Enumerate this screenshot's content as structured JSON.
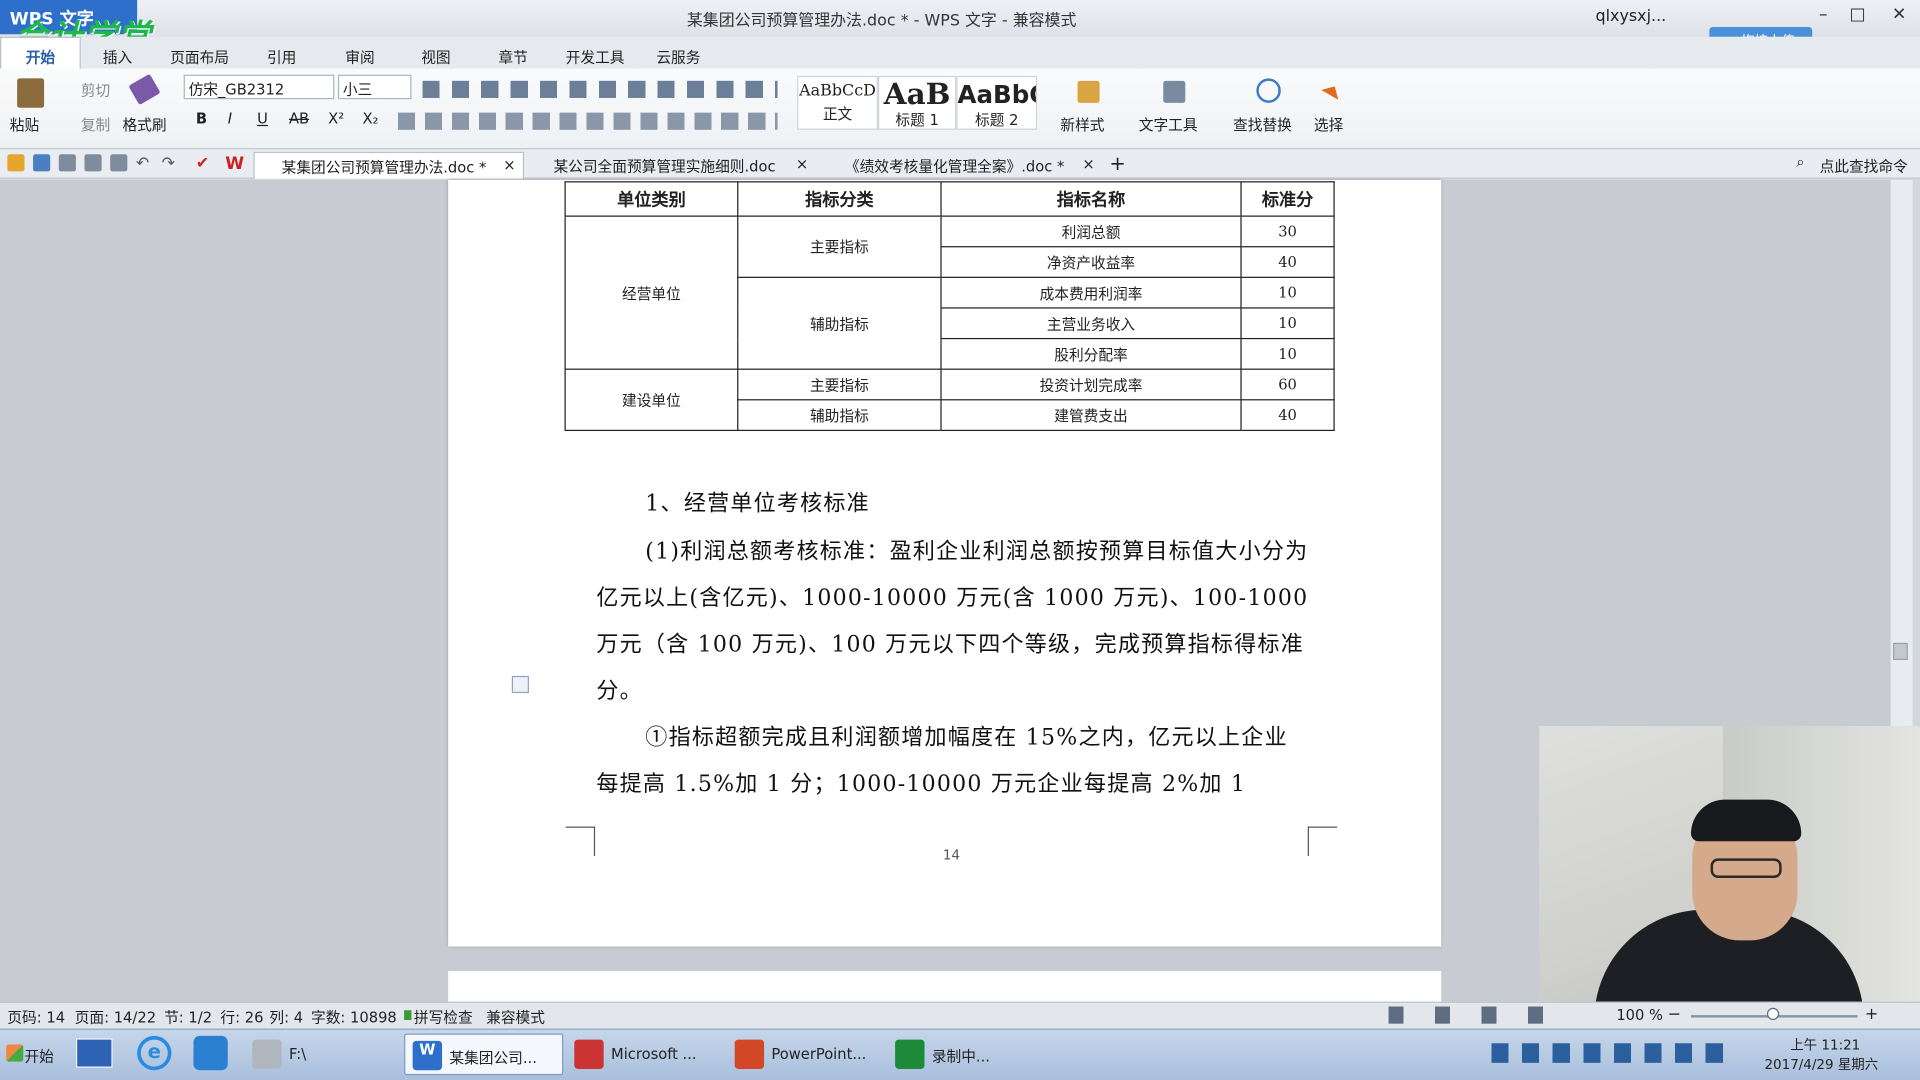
{
  "app": {
    "name": "WPS 文字",
    "brand": "会计学堂",
    "title": "某集团公司预算管理办法.doc * - WPS 文字 - 兼容模式",
    "user": "qlxysxj...",
    "upload": "拖拽上传"
  },
  "menu": [
    "开始",
    "插入",
    "页面布局",
    "引用",
    "审阅",
    "视图",
    "章节",
    "开发工具",
    "云服务"
  ],
  "ribbon": {
    "paste": "粘贴",
    "cut": "剪切",
    "copy": "复制",
    "format_painter": "格式刷",
    "font": "仿宋_GB2312",
    "size": "小三",
    "styles": [
      {
        "sample": "AaBbCcD",
        "name": "正文"
      },
      {
        "sample": "AaB",
        "name": "标题 1"
      },
      {
        "sample": "AaBbC",
        "name": "标题 2"
      }
    ],
    "new_style": "新样式",
    "text_tools": "文字工具",
    "find_replace": "查找替换",
    "select": "选择",
    "bold": "B",
    "italic": "I",
    "underline": "U",
    "strike": "AB",
    "sup": "X²",
    "sub": "X₂"
  },
  "doc_tabs": [
    {
      "label": "某集团公司预算管理办法.doc *",
      "active": true
    },
    {
      "label": "某公司全面预算管理实施细则.doc",
      "active": false
    },
    {
      "label": "《绩效考核量化管理全案》.doc *",
      "active": false
    }
  ],
  "find_command": "点此查找命令",
  "table": {
    "headers": [
      "单位类别",
      "指标分类",
      "指标名称",
      "标准分"
    ],
    "groups": [
      {
        "unit": "经营单位",
        "cats": [
          {
            "cat": "主要指标",
            "items": [
              {
                "name": "利润总额",
                "score": "30"
              },
              {
                "name": "净资产收益率",
                "score": "40"
              }
            ]
          },
          {
            "cat": "辅助指标",
            "items": [
              {
                "name": "成本费用利润率",
                "score": "10"
              },
              {
                "name": "主营业务收入",
                "score": "10"
              },
              {
                "name": "股利分配率",
                "score": "10"
              }
            ]
          }
        ]
      },
      {
        "unit": "建设单位",
        "cats": [
          {
            "cat": "主要指标",
            "items": [
              {
                "name": "投资计划完成率",
                "score": "60"
              }
            ]
          },
          {
            "cat": "辅助指标",
            "items": [
              {
                "name": "建管费支出",
                "score": "40"
              }
            ]
          }
        ]
      }
    ]
  },
  "body": {
    "heading": "1、经营单位考核标准",
    "p1": "(1)利润总额考核标准：盈利企业利润总额按预算目标值大小分为亿元以上(含亿元)、1000-10000 万元(含 1000 万元)、100-1000 万元（含 100 万元)、100 万元以下四个等级，完成预算指标得标准分。",
    "p2": "①指标超额完成且利润额增加幅度在 15%之内，亿元以上企业每提高 1.5%加 1 分；1000-10000 万元企业每提高 2%加 1"
  },
  "page_number": "14",
  "status": {
    "page_code": "页码: 14",
    "pages": "页面: 14/22",
    "section": "节: 1/2",
    "row": "行: 26",
    "col": "列: 4",
    "words": "字数: 10898",
    "spell": "拼写检查",
    "compat": "兼容模式",
    "zoom": "100 %"
  },
  "taskbar": {
    "start": "开始",
    "drive": "F:\\",
    "items": [
      "某集团公司...",
      "Microsoft ...",
      "PowerPoint...",
      "录制中..."
    ],
    "time": "上午 11:21",
    "date": "2017/4/29 星期六"
  }
}
